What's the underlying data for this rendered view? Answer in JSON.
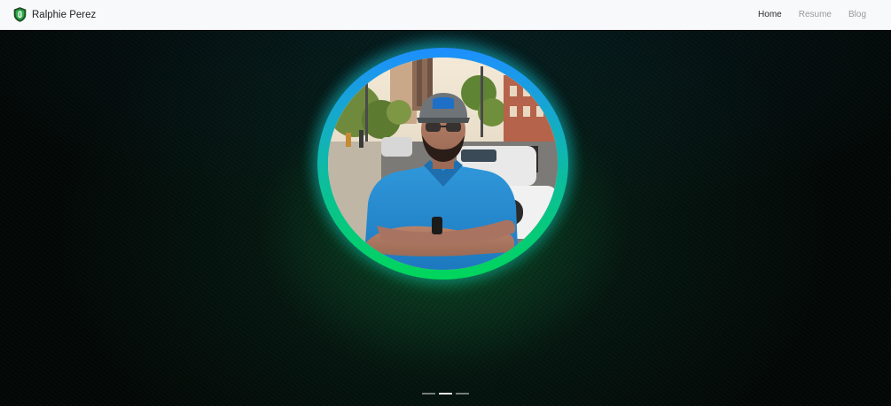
{
  "navbar": {
    "brand_name": "Ralphie Perez",
    "brand_icon": "shield-icon",
    "links": [
      {
        "label": "Home",
        "active": true
      },
      {
        "label": "Resume",
        "active": false
      },
      {
        "label": "Blog",
        "active": false
      }
    ]
  },
  "hero": {
    "profile_image": "profile-photo",
    "ring_colors": [
      "#1e8fff",
      "#00d65a"
    ],
    "carousel": {
      "count": 3,
      "active_index": 1
    }
  }
}
